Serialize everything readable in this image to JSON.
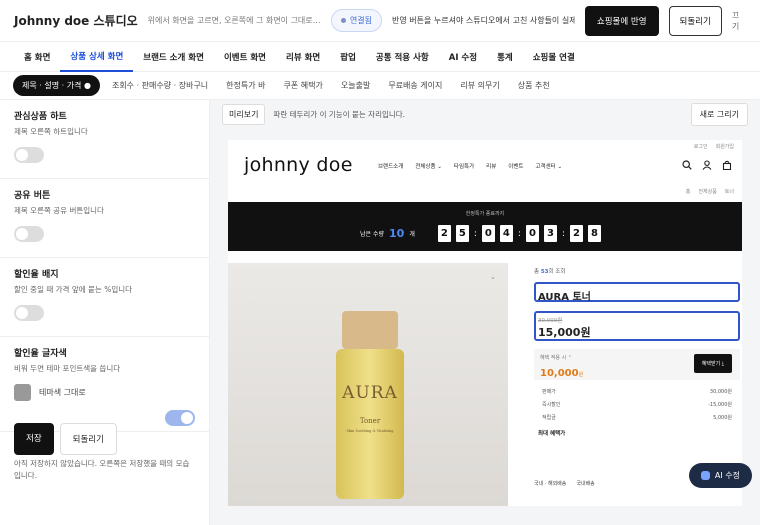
{
  "header": {
    "brand": "Johnny doe 스튜디오",
    "hint": "위에서 화면을 고르면, 오른쪽에 그 화면이 그대로 …",
    "connection": "연결됨",
    "notice": "반영 버튼을 누르셔야 스튜디오에서 고친 사항들이 실제로 …",
    "apply_label": "쇼핑몰에 반영",
    "revert_label": "되돌리기",
    "close_label": "끄기"
  },
  "main_tabs": [
    "홈 화면",
    "상품 상세 화면",
    "브랜드 소개 화면",
    "이벤트 화면",
    "리뷰 화면",
    "팝업",
    "공통 적용 사항",
    "AI 수정",
    "통계",
    "쇼핑몰 연결"
  ],
  "sub_tabs": [
    "제목 · 설명 · 가격 ●",
    "조회수 · 판매수량 · 장바구니",
    "한정특가 바",
    "쿠폰 혜택가",
    "오늘출발",
    "무료배송 게이지",
    "리뷰 의무기",
    "상품 추천"
  ],
  "settings": [
    {
      "title": "관심상품 하트",
      "desc": "제목 오른쪽 하트입니다"
    },
    {
      "title": "공유 버튼",
      "desc": "제목 오른쪽 공유 버튼입니다"
    },
    {
      "title": "할인율 배지",
      "desc": "할인 중일 때 가격 앞에 붙는 %입니다"
    },
    {
      "title": "할인율 글자색",
      "desc": "비워 두면 테마 포인트색을 씁니다",
      "swatch_label": "테마색 그대로"
    }
  ],
  "save_label": "저장",
  "revert2_label": "되돌리기",
  "save_note": "아직 저장하지 않았습니다. 오른쪽은 저장했을 때의 모습입니다.",
  "preview": {
    "tag": "미리보기",
    "desc": "파란 테두리가 이 기능이 붙는 자리입니다.",
    "redraw": "새로 그리기"
  },
  "shop": {
    "util": [
      "로그인",
      "회원가입"
    ],
    "logo": "johnny  doe",
    "nav": [
      "브랜드소개",
      "전체상품 ⌄",
      "타임특가",
      "리뷰",
      "이벤트",
      "고객센터 ⌄"
    ],
    "breadcrumb": [
      "홈",
      "전체상품",
      "토너"
    ],
    "timer_title": "한정특가 종료까지",
    "stock_prefix": "남은 수량",
    "stock": "10",
    "stock_unit": "개",
    "digits": [
      "2",
      "5",
      "0",
      "4",
      "0",
      "3",
      "2",
      "8"
    ],
    "product_label": "AURA",
    "product_sub": "Toner",
    "product_sub2": "Skin Soothing & Vitalizing",
    "sold_prefix": "총",
    "sold_count": "53",
    "sold_suffix": "회 조회",
    "name": "AURA 토너",
    "original_price": "30,000원",
    "price": "15,000원",
    "benefit_label": "혜택 적용 시 ⌃",
    "benefit_price": "10,000",
    "benefit_unit": "원",
    "benefit_btn": "혜택받기 ⤓",
    "rows": [
      {
        "k": "판매가",
        "v": "30,000원"
      },
      {
        "k": "즉시할인",
        "v": "-15,000원"
      },
      {
        "k": "적립금",
        "v": "5,000원"
      }
    ],
    "max_benefit": "최대 혜택가",
    "ship": [
      "국내 · 해외배송",
      "국내배송"
    ],
    "ai_label": "AI 수정"
  },
  "colors": {
    "accent": "#1d4ed8",
    "outline": "#2f55c7",
    "orange": "#e07b16"
  }
}
